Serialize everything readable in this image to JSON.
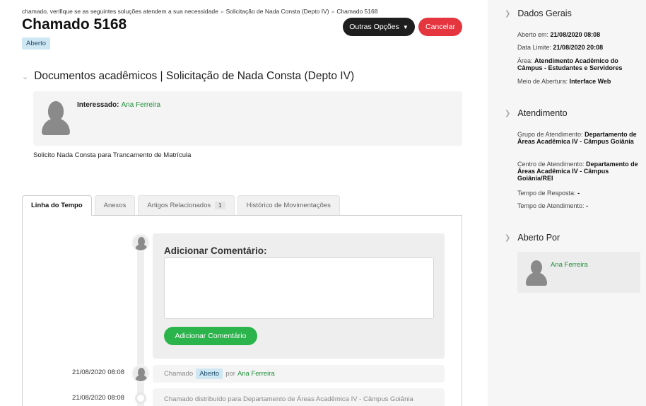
{
  "breadcrumb": {
    "items": [
      "chamado, verifique se as seguintes soluções atendem a sua necessidade",
      "Solicitação de Nada Consta (Depto IV)",
      "Chamado 5168"
    ],
    "separator": "»"
  },
  "ticket": {
    "title": "Chamado 5168",
    "status": "Aberto",
    "section_title": "Documentos acadêmicos | Solicitação de Nada Consta (Depto IV)",
    "interested_label": "Interessado:",
    "interested_name": "Ana Ferreira",
    "description": "Solicito Nada Consta para Trancamento de Matrícula"
  },
  "actions": {
    "more_options": "Outras Opções",
    "cancel": "Cancelar"
  },
  "tabs": [
    {
      "label": "Linha do Tempo",
      "active": true
    },
    {
      "label": "Anexos",
      "active": false
    },
    {
      "label": "Artigos Relacionados",
      "count": "1",
      "active": false
    },
    {
      "label": "Histórico de Movimentações",
      "active": false
    }
  ],
  "comment": {
    "title": "Adicionar Comentário:",
    "input_value": "",
    "submit": "Adicionar Comentário"
  },
  "timeline": [
    {
      "date": "21/08/2020 08:08",
      "prefix": "Chamado",
      "tag": "Aberto",
      "by": "por",
      "name": "Ana Ferreira"
    },
    {
      "date": "21/08/2020 08:08",
      "text": "Chamado distribuído para Departamento de Áreas Acadêmica IV - Câmpus Goiânia"
    }
  ],
  "sidebar": {
    "general": {
      "title": "Dados Gerais",
      "opened_label": "Aberto em:",
      "opened_value": "21/08/2020 08:08",
      "deadline_label": "Data Limite:",
      "deadline_value": "21/08/2020 20:08",
      "area_label": "Área:",
      "area_value": "Atendimento Acadêmico do Câmpus - Estudantes e Servidores",
      "channel_label": "Meio de Abertura:",
      "channel_value": "Interface Web"
    },
    "service": {
      "title": "Atendimento",
      "group_label": "Grupo de Atendimento:",
      "group_value": "Departamento de Áreas Acadêmica IV - Câmpus Goiânia",
      "center_label": "Centro de Atendimento:",
      "center_value": "Departamento de Áreas Acadêmica IV - Câmpus Goiânia/REI",
      "response_label": "Tempo de Resposta:",
      "response_value": "-",
      "attend_label": "Tempo de Atendimento:",
      "attend_value": "-"
    },
    "opened_by": {
      "title": "Aberto Por",
      "name": "Ana Ferreira"
    }
  },
  "colors": {
    "accent_green": "#2bb34c",
    "danger": "#e53640",
    "dark_button": "#1e1e1e",
    "status_badge": "#cfe6f3"
  },
  "icons": {
    "section_toggle": "chevron-down-icon",
    "more_options": "chevron-down-icon",
    "sidebar_toggle": "chevron-right-icon",
    "user": "user-avatar-icon"
  }
}
